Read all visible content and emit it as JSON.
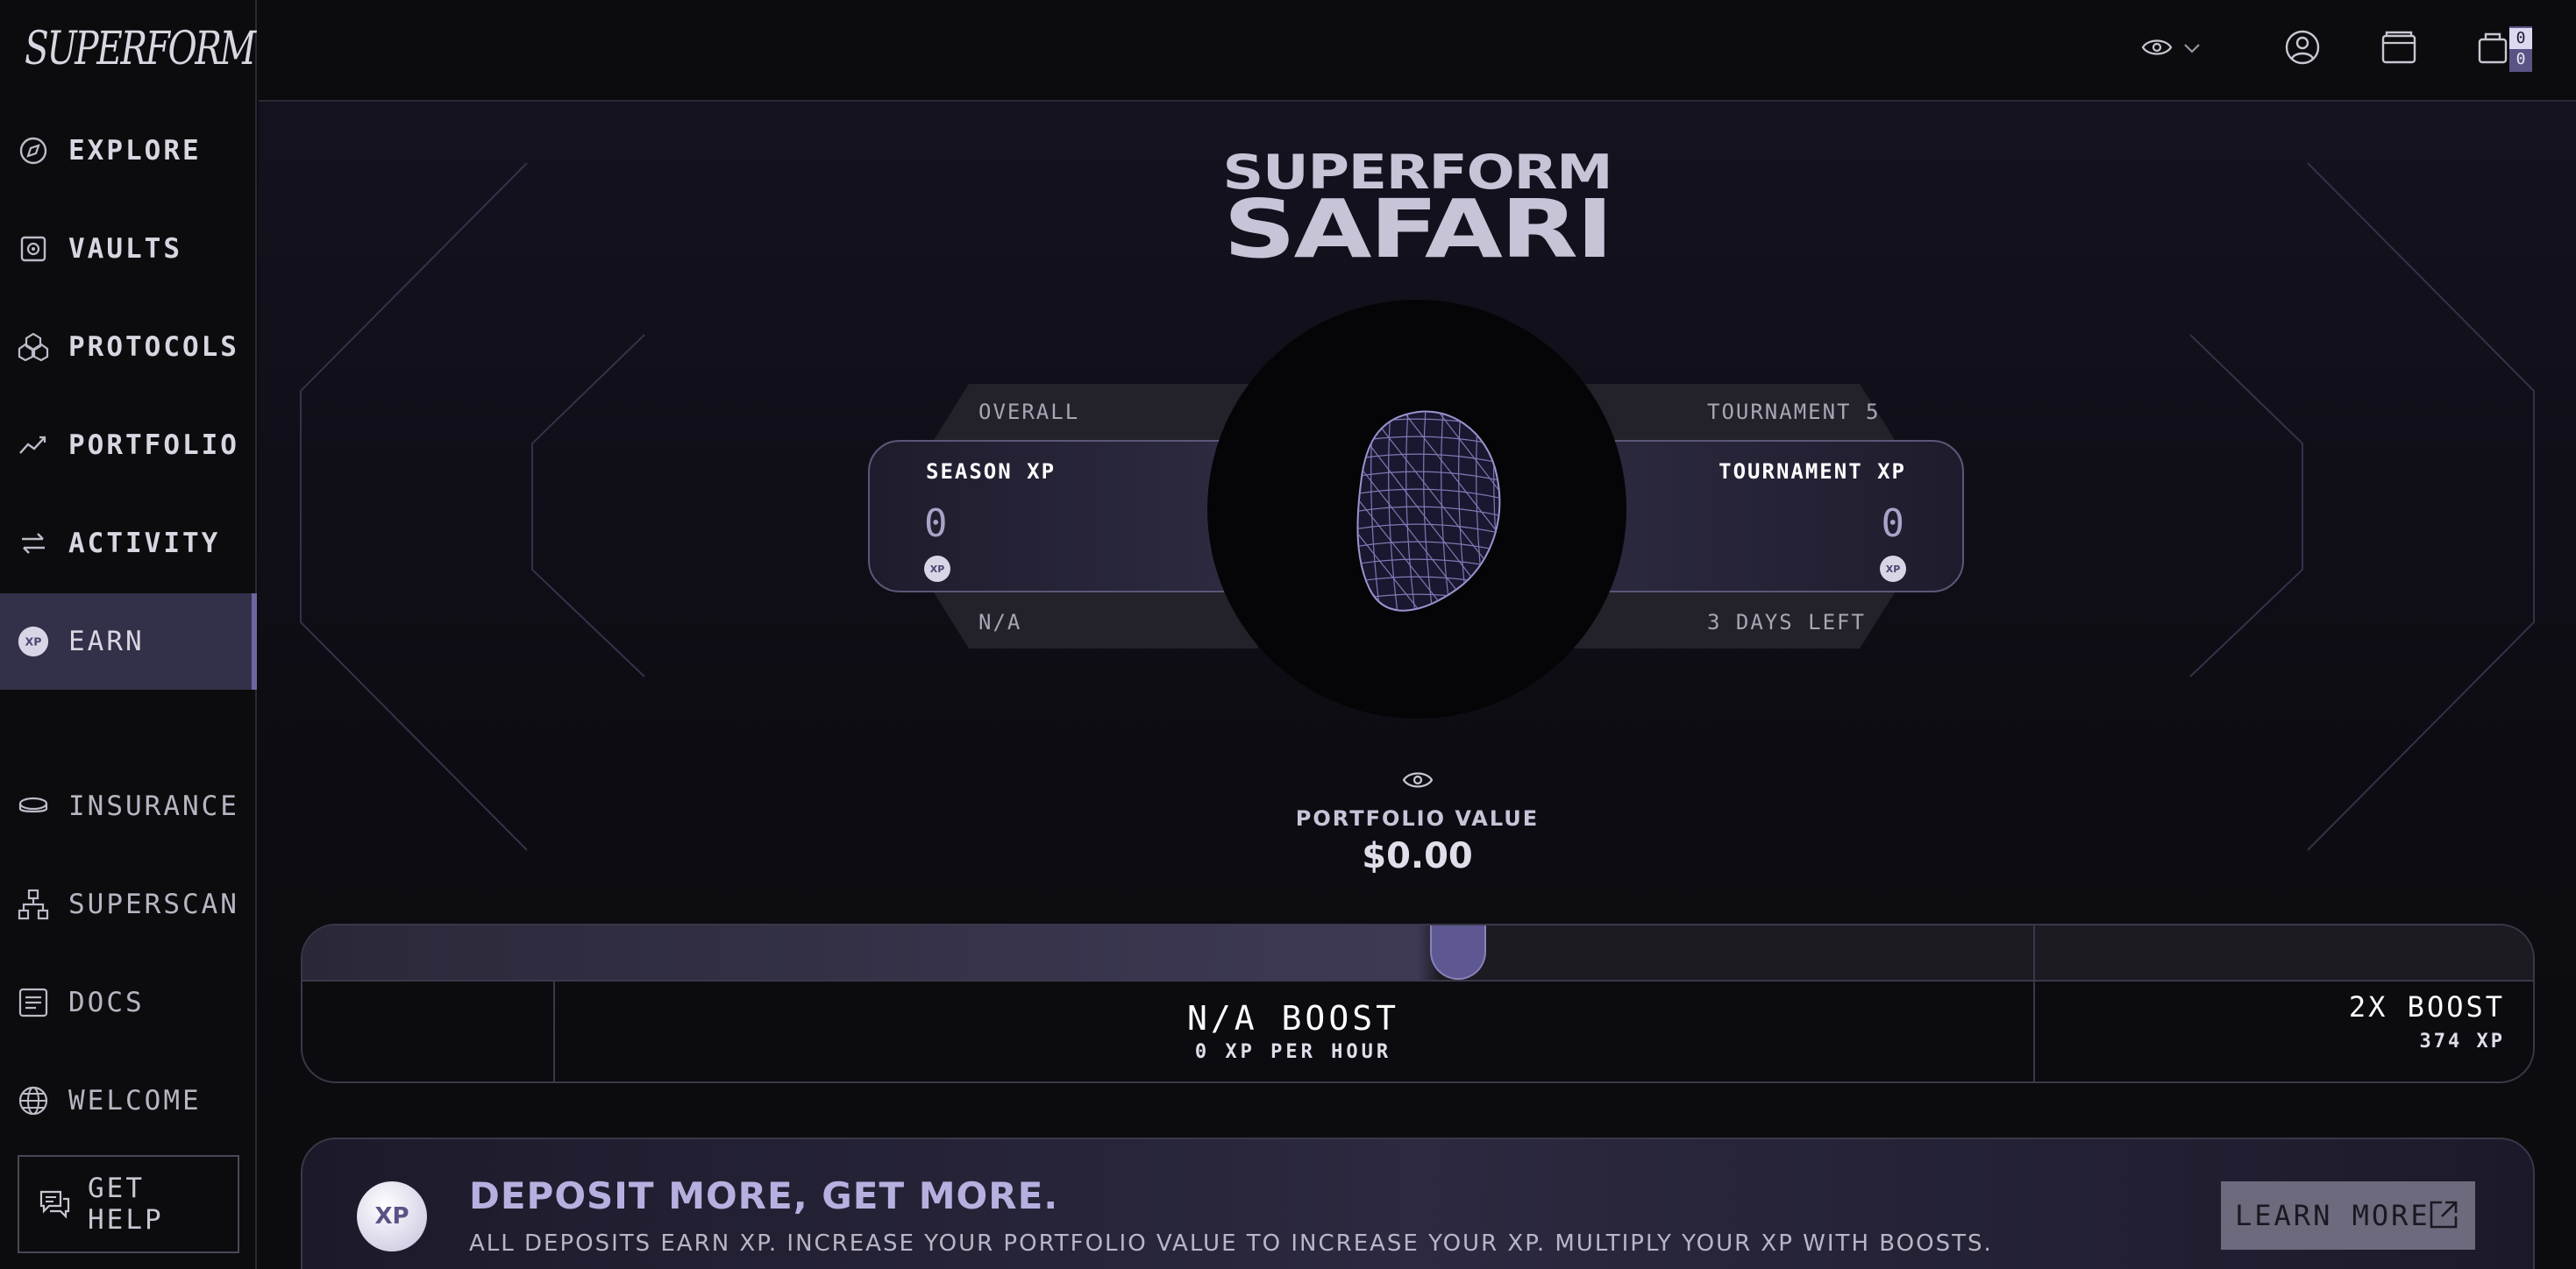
{
  "app": {
    "logo": "SUPERFORM"
  },
  "sidebar": {
    "items": [
      {
        "label": "EXPLORE",
        "icon": "compass-icon"
      },
      {
        "label": "VAULTS",
        "icon": "vault-icon"
      },
      {
        "label": "PROTOCOLS",
        "icon": "protocols-icon"
      },
      {
        "label": "PORTFOLIO",
        "icon": "chart-line-icon"
      },
      {
        "label": "ACTIVITY",
        "icon": "arrows-swap-icon"
      },
      {
        "label": "EARN",
        "icon": "xp-icon",
        "active": true
      }
    ],
    "secondary": [
      {
        "label": "INSURANCE",
        "icon": "insurance-icon"
      },
      {
        "label": "SUPERSCAN",
        "icon": "sitemap-icon"
      },
      {
        "label": "DOCS",
        "icon": "document-icon"
      },
      {
        "label": "WELCOME",
        "icon": "globe-icon"
      }
    ],
    "help": "GET HELP"
  },
  "topbar": {
    "cart_count_top": "0",
    "cart_count_bottom": "0"
  },
  "hero": {
    "title_small": "SUPERFORM",
    "title_big": "SAFARI"
  },
  "season": {
    "tab_top": "OVERALL",
    "tab_bottom": "N/A",
    "title": "SEASON XP",
    "value": "0",
    "badge": "XP"
  },
  "tournament": {
    "tab_top": "TOURNAMENT 5",
    "tab_bottom": "3 DAYS LEFT",
    "title": "TOURNAMENT XP",
    "value": "0",
    "badge": "XP"
  },
  "portfolio": {
    "label": "PORTFOLIO VALUE",
    "value": "$0.00"
  },
  "boost": {
    "current_title": "N/A BOOST",
    "current_sub": "0 XP PER HOUR",
    "next_title": "2X BOOST",
    "next_sub": "374 XP"
  },
  "deposit": {
    "badge": "XP",
    "title": "DEPOSIT MORE, GET MORE.",
    "text": "ALL DEPOSITS EARN XP. INCREASE YOUR PORTFOLIO VALUE TO INCREASE YOUR XP. MULTIPLY YOUR XP WITH BOOSTS.",
    "button": "LEARN MORE"
  },
  "colors": {
    "accent": "#6d66a0",
    "background": "#0c0c0e",
    "active_bg": "#33304a"
  }
}
